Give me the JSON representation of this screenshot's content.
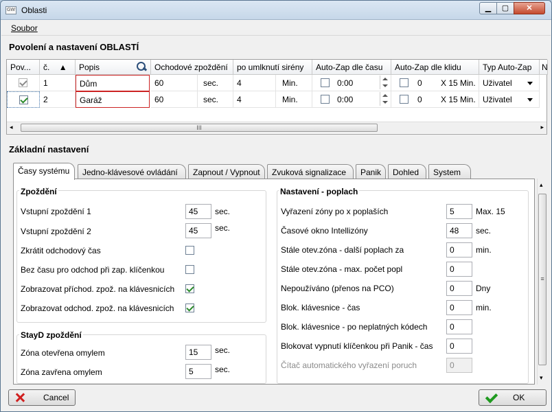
{
  "window": {
    "title": "Oblasti",
    "app_icon": "GW"
  },
  "menu": {
    "file": "Soubor"
  },
  "section_top": "Povolení a nastavení OBLASTÍ",
  "grid": {
    "headers": [
      "Pov...",
      "č.",
      "Popis",
      "Ochodové zpoždění",
      "po umlknutí sirény",
      "Auto-Zap dle času",
      "Auto-Zap dle klidu",
      "Typ Auto-Zap",
      "N"
    ],
    "sort_indicator": "▲",
    "rows": [
      {
        "enabled": true,
        "enabled_disabled": true,
        "num": "1",
        "desc": "Dům",
        "exit_delay": "60",
        "exit_unit": "sec.",
        "after_siren": "4",
        "after_siren_unit": "Min.",
        "time_checked": false,
        "time_value": "0:00",
        "idle_checked": false,
        "idle_value": "0",
        "idle_unit": "X 15 Min.",
        "type": "Uživatel"
      },
      {
        "enabled": true,
        "enabled_disabled": false,
        "num": "2",
        "desc": "Garáž",
        "exit_delay": "60",
        "exit_unit": "sec.",
        "after_siren": "4",
        "after_siren_unit": "Min.",
        "time_checked": false,
        "time_value": "0:00",
        "idle_checked": false,
        "idle_value": "0",
        "idle_unit": "X 15 Min.",
        "type": "Uživatel"
      }
    ],
    "scroll_grip": "III"
  },
  "section_basic": "Základní nastavení",
  "tabs": [
    "Časy systému",
    "Jedno-klávesové ovládání",
    "Zapnout / Vypnout",
    "Zvuková signalizace",
    "Panik",
    "Dohled",
    "System"
  ],
  "delay_group": {
    "title": "Zpoždění",
    "entry1": {
      "label": "Vstupní zpoždění 1",
      "value": "45",
      "unit": "sec."
    },
    "entry2": {
      "label": "Vstupní zpoždění 2",
      "value": "45",
      "unit": "sec."
    },
    "shorten": {
      "label": "Zkrátit odchodový čas",
      "checked": false
    },
    "nokey": {
      "label": "Bez času pro odchod při zap. klíčenkou",
      "checked": false
    },
    "show_entry": {
      "label": "Zobrazovat příchod. zpož. na klávesnicích",
      "checked": true
    },
    "show_exit": {
      "label": "Zobrazovat odchod. zpož. na klávesnicích",
      "checked": true
    }
  },
  "stayd_group": {
    "title": "StayD zpoždění",
    "open": {
      "label": "Zóna otevřena omylem",
      "value": "15",
      "unit": "sec."
    },
    "closed": {
      "label": "Zóna zavřena omylem",
      "value": "5",
      "unit": "sec."
    }
  },
  "alarm_group": {
    "title": "Nastavení - poplach",
    "f1": {
      "label": "Vyřazení zóny po x poplaších",
      "value": "5",
      "unit": "Max. 15"
    },
    "f2": {
      "label": "Časové okno Intellizóny",
      "value": "48",
      "unit": "sec."
    },
    "f3": {
      "label": "Stále otev.zóna - další poplach za",
      "value": "0",
      "unit": "min."
    },
    "f4": {
      "label": "Stále otev.zóna - max. počet popl",
      "value": "0",
      "unit": ""
    },
    "f5": {
      "label": "Nepoužíváno (přenos na PCO)",
      "value": "0",
      "unit": "Dny"
    },
    "f6": {
      "label": "Blok. klávesnice - čas",
      "value": "0",
      "unit": "min."
    },
    "f7": {
      "label": "Blok. klávesnice - po neplatných kódech",
      "value": "0",
      "unit": ""
    },
    "f8": {
      "label": "Blokovat vypnutí klíčenkou při Panik - čas",
      "value": "0",
      "unit": ""
    },
    "f9": {
      "label": "Čítač automatického vyřazení poruch",
      "value": "0",
      "unit": ""
    }
  },
  "buttons": {
    "cancel": "Cancel",
    "ok": "OK"
  }
}
